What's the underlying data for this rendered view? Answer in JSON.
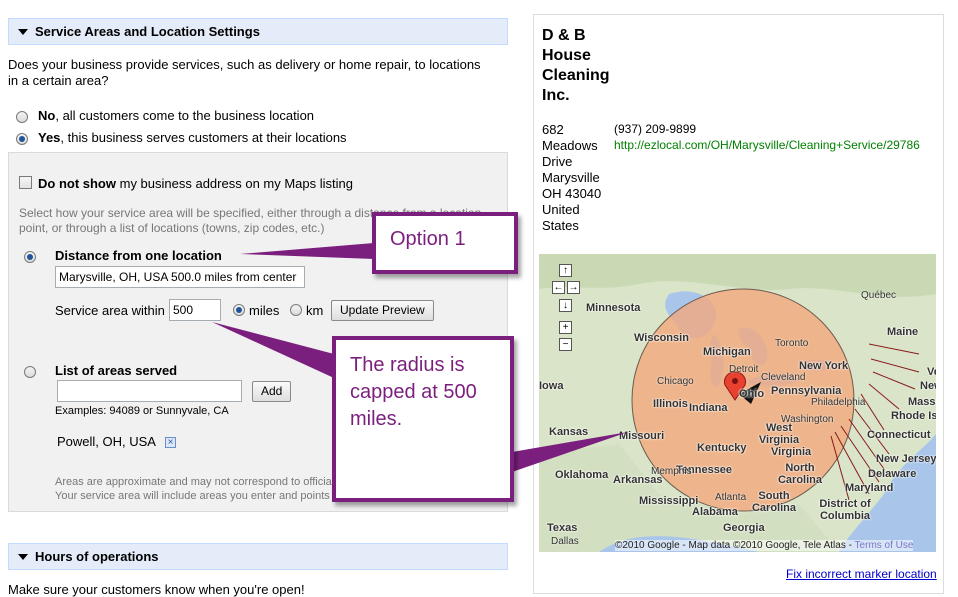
{
  "service_section": {
    "header": "Service Areas and Location Settings",
    "question": "Does your business provide services, such as delivery or home repair, to locations in a certain area?",
    "option_no_bold": "No",
    "option_no_rest": ", all customers come to the business location",
    "option_yes_bold": "Yes",
    "option_yes_rest": ", this business serves customers at their locations",
    "do_not_show_bold": "Do not show",
    "do_not_show_rest": " my business address on my Maps listing",
    "select_help": "Select how your service area will be specified, either through a distance from a location point, or through a list of locations (towns, zip codes, etc.)",
    "distance_label": "Distance from one location",
    "distance_value": "Marysville, OH, USA 500.0 miles from center",
    "service_within_label": "Service area within",
    "service_within_value": "500",
    "unit_miles": "miles",
    "unit_km": "km",
    "update_preview": "Update Preview",
    "list_label": "List of areas served",
    "add_button": "Add",
    "examples": "Examples: 94089 or Sunnyvale, CA",
    "area_item": "Powell, OH, USA",
    "approx_note_1": "Areas are approximate and may not correspond to official boundaries.",
    "approx_note_2": "Your service area will include areas you enter and points around them."
  },
  "hours_section": {
    "header": "Hours of operations",
    "intro": "Make sure your customers know when you're open!"
  },
  "listing": {
    "name_line1": "D & B",
    "name_line2": "House",
    "name_line3": "Cleaning",
    "name_line4": "Inc.",
    "address_lines": [
      "682",
      "Meadows",
      "Drive",
      "Marysville",
      "OH 43040",
      "United",
      "States"
    ],
    "phone": "(937) 209-9899",
    "url": "http://ezlocal.com/OH/Marysville/Cleaning+Service/29786",
    "fix_marker": "Fix incorrect marker location"
  },
  "map": {
    "states": [
      "Minnesota",
      "Wisconsin",
      "Michigan",
      "Iowa",
      "Illinois",
      "Indiana",
      "Ohio",
      "Pennsylvania",
      "New York",
      "Kansas",
      "Missouri",
      "Kentucky",
      "West Virginia",
      "Virginia",
      "Tennessee",
      "North Carolina",
      "Oklahoma",
      "Arkansas",
      "Mississippi",
      "Alabama",
      "Georgia",
      "South Carolina",
      "Texas",
      "Maine",
      "Québec",
      "Connecticut",
      "New Jersey",
      "Delaware",
      "Maryland",
      "District of Columbia",
      "Rhode Is",
      "Massa",
      "New",
      "Ve"
    ],
    "cities": [
      "Chicago",
      "Detroit",
      "Cleveland",
      "Toronto",
      "Philadelphia",
      "Washington",
      "Atlanta",
      "Memphis",
      "Dallas"
    ],
    "copyright": "©2010 Google - Map data ©2010 Google, Tele Atlas -",
    "terms": "Terms of Use"
  },
  "callouts": {
    "option1": "Option 1",
    "radius": "The radius is capped at 500 miles."
  },
  "colors": {
    "header_bg": "#e5ecf9",
    "header_border": "#c3d9ff",
    "url_green": "#008000",
    "link_blue": "#0000cc",
    "callout_purple": "#7b1f7e",
    "radius_fill": "#f3a77a"
  }
}
